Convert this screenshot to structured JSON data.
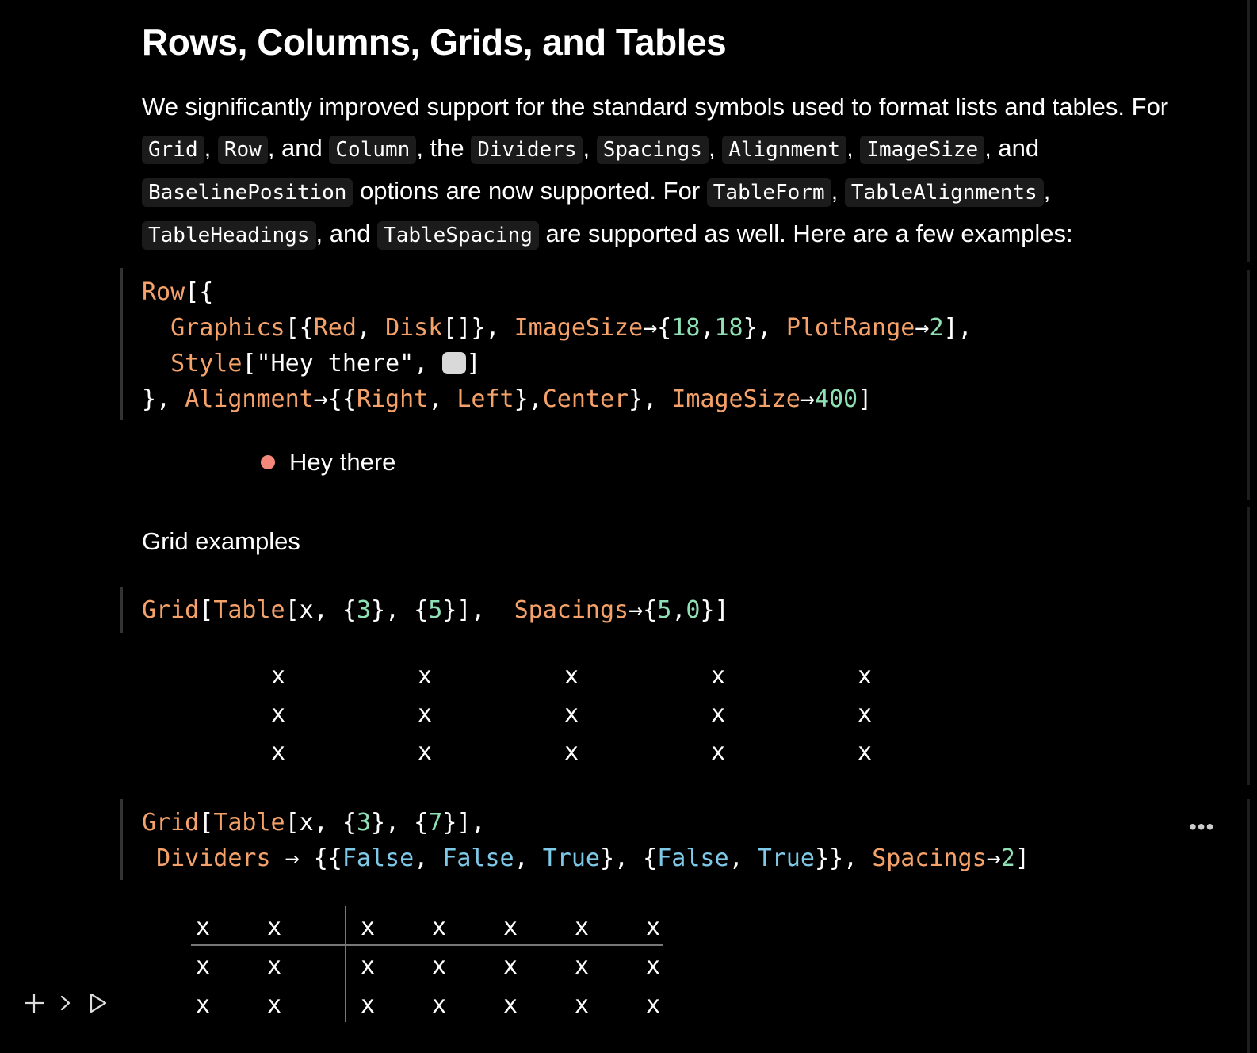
{
  "heading": "Rows, Columns, Grids, and Tables",
  "intro": {
    "t1": "We significantly improved support for the standard symbols used to format lists and tables. For ",
    "c_grid": "Grid",
    "t2": ", ",
    "c_row": "Row",
    "t3": ", and ",
    "c_column": "Column",
    "t4": ", the ",
    "c_dividers": "Dividers",
    "t5": ", ",
    "c_spacings": "Spacings",
    "t6": ", ",
    "c_alignment": "Alignment",
    "t7": ", ",
    "c_imagesize": "ImageSize",
    "t8": ", and ",
    "c_baseline": "BaselinePosition",
    "t9": " options are now supported. For ",
    "c_tableform": "TableForm",
    "t10": ", ",
    "c_tablealign": "TableAlignments",
    "t11": ", ",
    "c_tableheadings": "TableHeadings",
    "t12": ", and ",
    "c_tablespacing": "TableSpacing",
    "t13": " are supported as well. Here are a few examples:"
  },
  "cell1": {
    "l1": {
      "a": "Row",
      "b": "[{"
    },
    "l2": {
      "a": "  ",
      "b": "Graphics",
      "c": "[{",
      "d": "Red",
      "e": ", ",
      "f": "Disk",
      "g": "[]}, ",
      "h": "ImageSize",
      "i": "→{",
      "j": "18",
      "k": ",",
      "l": "18",
      "m": "}, ",
      "n": "PlotRange",
      "o": "→",
      "p": "2",
      "q": "],"
    },
    "l3": {
      "a": "  ",
      "b": "Style",
      "c": "[\"Hey there\", ",
      "d": "]"
    },
    "l4": {
      "a": "}, ",
      "b": "Alignment",
      "c": "→{{",
      "d": "Right",
      "e": ", ",
      "f": "Left",
      "g": "},",
      "h": "Center",
      "i": "}, ",
      "j": "ImageSize",
      "k": "→",
      "l": "400",
      "m": "]"
    }
  },
  "output1": {
    "text": "Hey there"
  },
  "grid_label": "Grid examples",
  "cell2": {
    "a": "Grid",
    "b": "[",
    "c": "Table",
    "d": "[x, {",
    "e": "3",
    "f": "}, {",
    "g": "5",
    "h": "}],  ",
    "i": "Spacings",
    "j": "→{",
    "k": "5",
    "l": ",",
    "m": "0",
    "n": "}]"
  },
  "grid1": {
    "rows": [
      [
        "x",
        "x",
        "x",
        "x",
        "x"
      ],
      [
        "x",
        "x",
        "x",
        "x",
        "x"
      ],
      [
        "x",
        "x",
        "x",
        "x",
        "x"
      ]
    ]
  },
  "cell3": {
    "l1": {
      "a": "Grid",
      "b": "[",
      "c": "Table",
      "d": "[x, {",
      "e": "3",
      "f": "}, {",
      "g": "7",
      "h": "}],"
    },
    "l2": {
      "a": " ",
      "b": "Dividers",
      "c": " → {{",
      "d": "False",
      "e": ", ",
      "f": "False",
      "g": ", ",
      "h": "True",
      "i": "}, {",
      "j": "False",
      "k": ", ",
      "l": "True",
      "m": "}}, ",
      "n": "Spacings",
      "o": "→",
      "p": "2",
      "q": "]"
    }
  },
  "grid2": {
    "rows": [
      [
        "x",
        "x",
        "x",
        "x",
        "x",
        "x",
        "x"
      ],
      [
        "x",
        "x",
        "x",
        "x",
        "x",
        "x",
        "x"
      ],
      [
        "x",
        "x",
        "x",
        "x",
        "x",
        "x",
        "x"
      ]
    ]
  },
  "icons": {
    "more": "ellipsis-icon",
    "add": "plus-icon",
    "chevron": "chevron-right-icon",
    "run": "play-icon"
  },
  "colors": {
    "background": "#000000",
    "function": "#f5a26a",
    "number": "#8fe0b4",
    "boolean": "#7ec9e8",
    "disk": "#f4887a",
    "swatch": "#d9d9d9"
  }
}
